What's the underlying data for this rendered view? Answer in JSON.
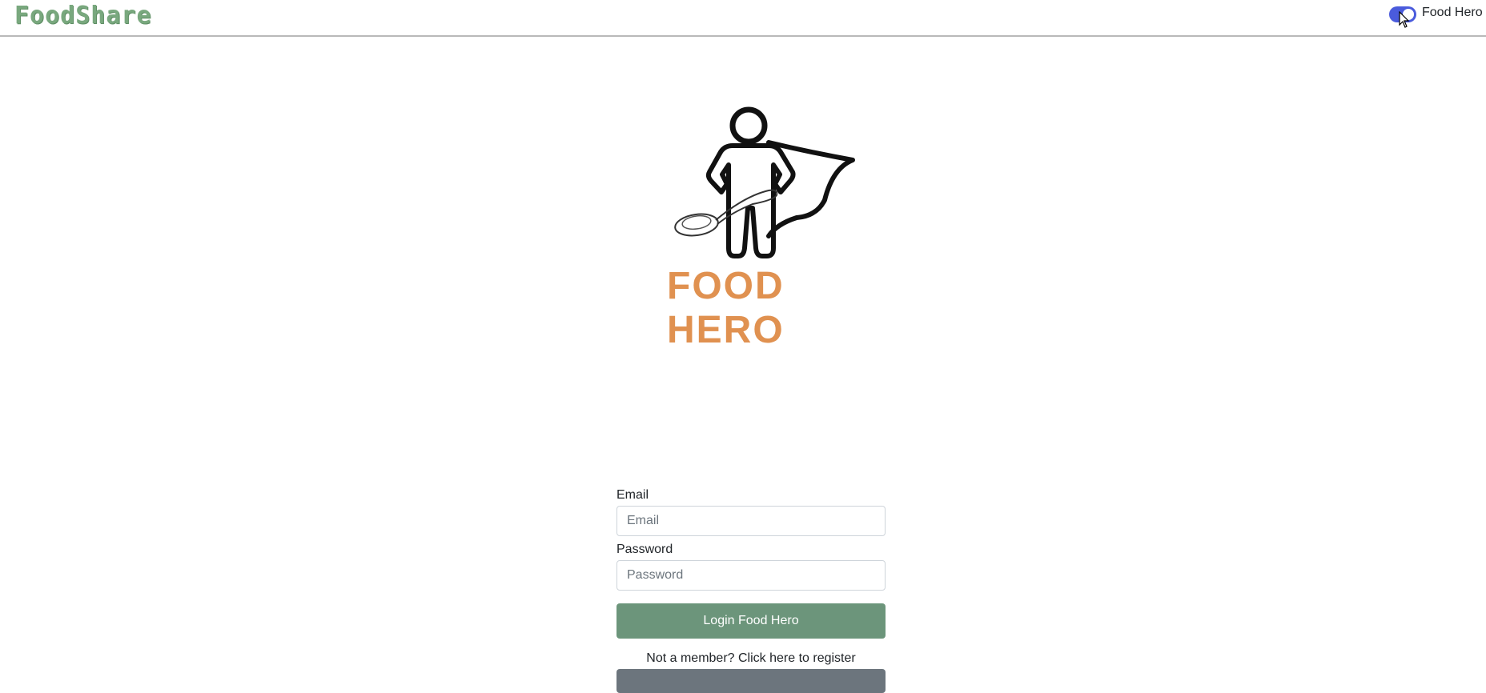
{
  "navbar": {
    "brand": "FoodShare",
    "toggle_label": "Food Hero",
    "toggle_on": true
  },
  "hero": {
    "logo_text": "FOOD HERO"
  },
  "login": {
    "email_label": "Email",
    "email_placeholder": "Email",
    "email_value": "",
    "password_label": "Password",
    "password_placeholder": "Password",
    "password_value": "",
    "submit_label": "Login Food Hero",
    "register_text": "Not a member? Click here to register"
  },
  "colors": {
    "brand": "#79a87e",
    "toggle": "#4a5bdc",
    "login_button": "#6c957b",
    "logo_text": "#e09150",
    "register_button": "#6c757d"
  }
}
